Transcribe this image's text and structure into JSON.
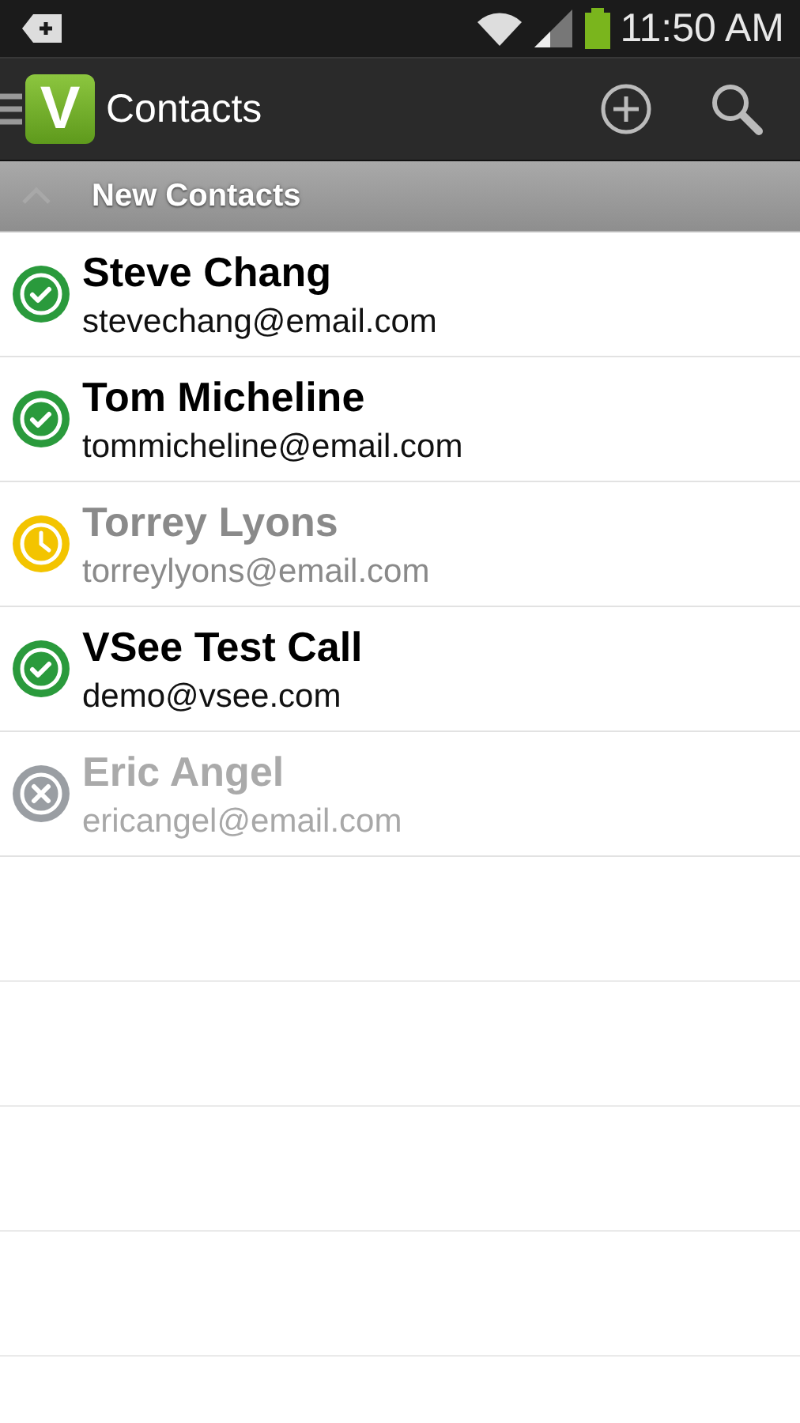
{
  "status_bar": {
    "time": "11:50 AM"
  },
  "action_bar": {
    "logo": "V",
    "title": "Contacts"
  },
  "section": {
    "title": "New Contacts",
    "expanded": true
  },
  "contacts": [
    {
      "name": "Steve Chang",
      "email": "stevechang@email.com",
      "kind": "online"
    },
    {
      "name": "Tom Micheline",
      "email": "tommicheline@email.com",
      "kind": "online"
    },
    {
      "name": "Torrey Lyons",
      "email": "torreylyons@email.com",
      "kind": "away"
    },
    {
      "name": "VSee Test Call",
      "email": "demo@vsee.com",
      "kind": "online"
    },
    {
      "name": "Eric Angel",
      "email": "ericangel@email.com",
      "kind": "offline"
    }
  ]
}
